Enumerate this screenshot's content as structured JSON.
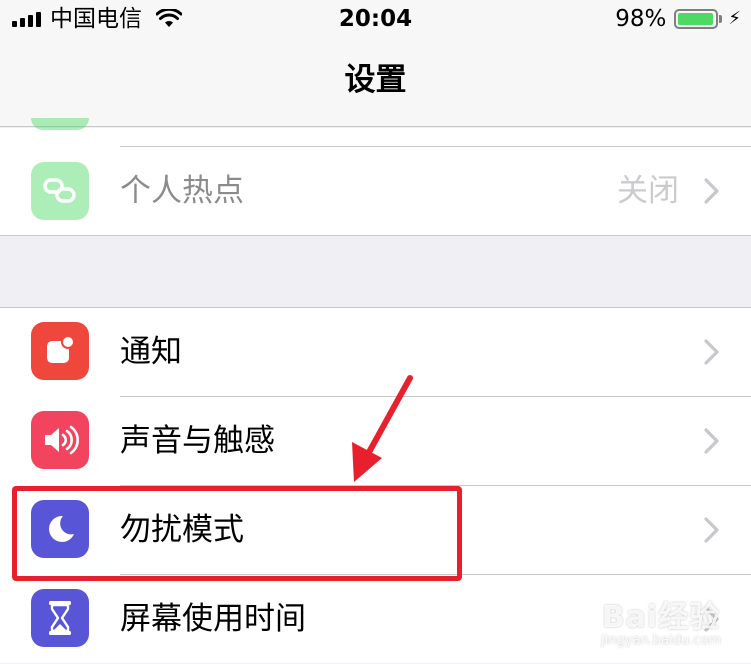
{
  "status_bar": {
    "carrier": "中国电信",
    "time": "20:04",
    "battery_percent": "98%",
    "battery_level": 0.98,
    "signal_bars": 4,
    "icons": [
      "signal-icon",
      "wifi-icon",
      "battery-icon",
      "charging-bolt-icon"
    ]
  },
  "nav": {
    "title": "设置"
  },
  "settings": {
    "hotspot": {
      "label": "个人热点",
      "value": "关闭",
      "icon": "hotspot-link-icon",
      "icon_color": "#4cd964",
      "dimmed": true
    },
    "notifications": {
      "label": "通知",
      "icon": "notification-badge-icon",
      "icon_color": "#f0473c"
    },
    "sounds": {
      "label": "声音与触感",
      "icon": "speaker-icon",
      "icon_color": "#f2435f"
    },
    "do_not_disturb": {
      "label": "勿扰模式",
      "icon": "moon-icon",
      "icon_color": "#5856d6",
      "highlighted": true
    },
    "screen_time": {
      "label": "屏幕使用时间",
      "icon": "hourglass-icon",
      "icon_color": "#5856d6"
    }
  },
  "annotation": {
    "color": "#e8202e",
    "target": "do_not_disturb"
  },
  "watermark": {
    "logo": "Bai经验",
    "url": "jingyan.baidu.com"
  }
}
